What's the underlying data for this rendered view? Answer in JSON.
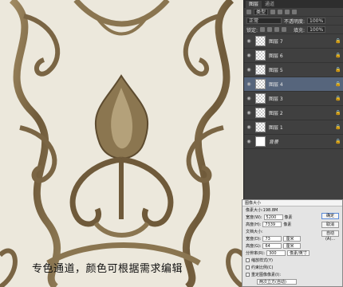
{
  "panel_tabs": [
    "图层",
    "通道"
  ],
  "toolbar": {
    "kind": "类型"
  },
  "blend": {
    "mode": "正常",
    "opacity_label": "不透明度:",
    "opacity": "100%"
  },
  "lock_row": {
    "label": "锁定:",
    "fill_label": "填充:",
    "fill": "100%"
  },
  "layers": [
    {
      "name": "图层 7",
      "selected": false
    },
    {
      "name": "图层 6",
      "selected": false
    },
    {
      "name": "图层 5",
      "selected": false
    },
    {
      "name": "图层 4",
      "selected": true
    },
    {
      "name": "图层 3",
      "selected": false
    },
    {
      "name": "图层 2",
      "selected": false
    },
    {
      "name": "图层 1",
      "selected": false
    },
    {
      "name": "背景",
      "selected": false
    }
  ],
  "dialog": {
    "title": "图像大小",
    "pixel_size": "像素大小:198.8M",
    "width_label": "宽度(W):",
    "width_value": "5200",
    "height_label": "高度(H):",
    "height_value": "7339",
    "pixel_unit": "像素",
    "doc_size": "文档大小:",
    "doc_width_label": "宽度(D):",
    "doc_width_value": "73",
    "doc_height_label": "高度(G):",
    "doc_height_value": "64",
    "cm_unit": "厘米",
    "res_label": "分辨率(R):",
    "res_value": "300",
    "res_unit": "像素/英寸",
    "opt1": "缩放样式(Y)",
    "opt2": "约束比例(C)",
    "opt3": "重定图像像素(I):",
    "resample": "两次立方(自动)",
    "ok": "确定",
    "cancel": "取消",
    "auto": "自动(A)..."
  },
  "caption": "专色通道，颜色可根据需求编辑"
}
